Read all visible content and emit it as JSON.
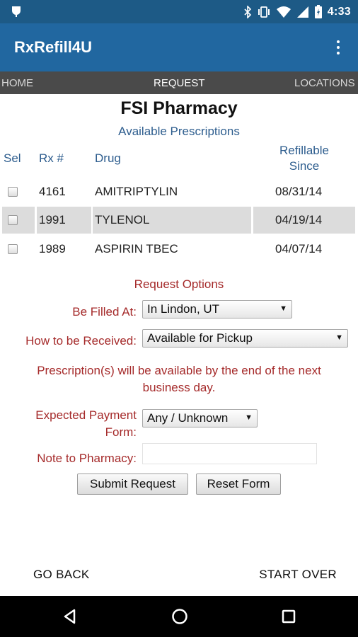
{
  "status_bar": {
    "time": "4:33"
  },
  "app": {
    "title": "RxRefill4U"
  },
  "tabs": {
    "home": "HOME",
    "request": "REQUEST",
    "locations": "LOCATIONS"
  },
  "pharmacy": {
    "name": "FSI Pharmacy",
    "subtitle": "Available Prescriptions"
  },
  "table": {
    "headers": {
      "sel": "Sel",
      "rx": "Rx #",
      "drug": "Drug",
      "refillable_1": "Refillable",
      "refillable_2": "Since"
    },
    "rows": [
      {
        "rx": "4161",
        "drug": "AMITRIPTYLIN",
        "since": "08/31/14"
      },
      {
        "rx": "1991",
        "drug": "TYLENOL",
        "since": "04/19/14"
      },
      {
        "rx": "1989",
        "drug": "ASPIRIN TBEC",
        "since": "04/07/14"
      }
    ]
  },
  "options": {
    "title": "Request Options",
    "filled_at_label": "Be Filled At:",
    "filled_at_value": "In Lindon, UT",
    "received_label": "How to be Received:",
    "received_value": "Available for Pickup",
    "message_line1": "Prescription(s) will be available by the end of the next",
    "message_line2": "business day.",
    "payment_label_1": "Expected Payment",
    "payment_label_2": "Form:",
    "payment_value": "Any / Unknown",
    "note_label": "Note to Pharmacy:",
    "note_value": ""
  },
  "buttons": {
    "submit": "Submit Request",
    "reset": "Reset Form"
  },
  "footer": {
    "back": "GO BACK",
    "start_over": "START OVER"
  },
  "colors": {
    "status_bar": "#1d5a86",
    "app_bar": "#2167a0",
    "tab_bar": "#4a4a4a",
    "label_blue": "#2d5d8e",
    "label_red": "#a52a2a",
    "selected_row": "#dcdcdc"
  }
}
